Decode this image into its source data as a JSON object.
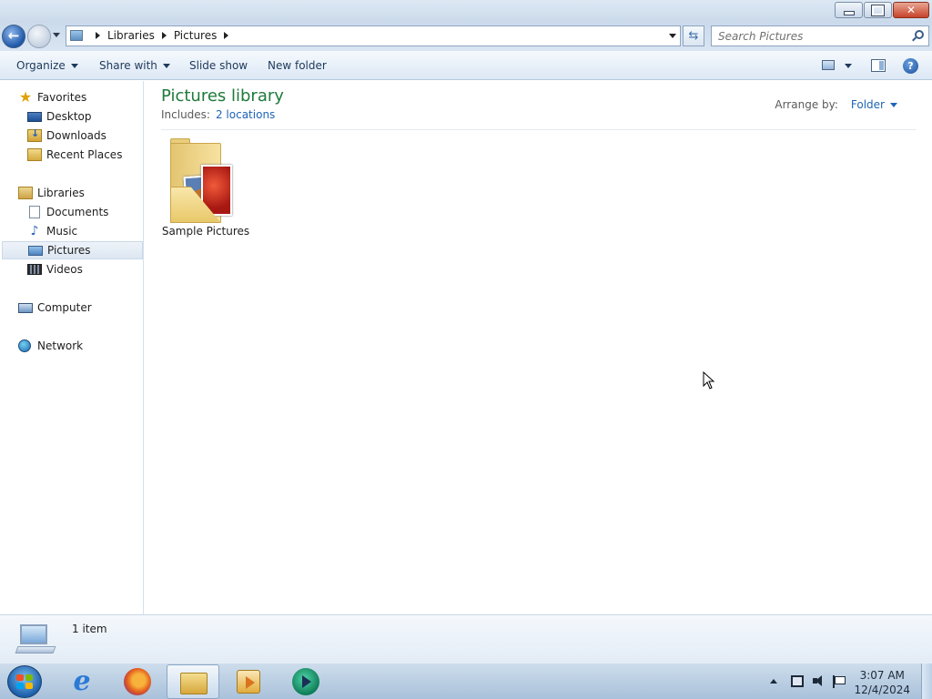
{
  "window": {
    "title": "",
    "buttons": {
      "minimize": "minimize",
      "maximize": "restore",
      "close": "close"
    }
  },
  "address": {
    "crumbs": [
      "Libraries",
      "Pictures"
    ],
    "search_placeholder": "Search Pictures"
  },
  "toolbar": {
    "organize": "Organize",
    "share_with": "Share with",
    "slide_show": "Slide show",
    "new_folder": "New folder"
  },
  "nav": {
    "favorites": "Favorites",
    "desktop": "Desktop",
    "downloads": "Downloads",
    "recent_places": "Recent Places",
    "libraries": "Libraries",
    "documents": "Documents",
    "music": "Music",
    "pictures": "Pictures",
    "videos": "Videos",
    "computer": "Computer",
    "network": "Network",
    "selected": "Pictures"
  },
  "main": {
    "title": "Pictures library",
    "includes_label": "Includes:",
    "includes_link": "2 locations",
    "arrange_label": "Arrange by:",
    "arrange_value": "Folder",
    "items": [
      {
        "name": "Sample Pictures",
        "icon": "picture-folder-icon"
      }
    ]
  },
  "details": {
    "count": "1 item"
  },
  "taskbar": {
    "apps": [
      "internet-explorer-icon",
      "firefox-icon",
      "windows-explorer-icon",
      "media-player-icon",
      "green-app-icon"
    ],
    "active_app": "windows-explorer-icon",
    "time": "3:07 AM",
    "date": "12/4/2024"
  },
  "colors": {
    "library_title": "#1e7a3b",
    "link": "#1f64b8",
    "chrome": "#cbdaeb"
  }
}
